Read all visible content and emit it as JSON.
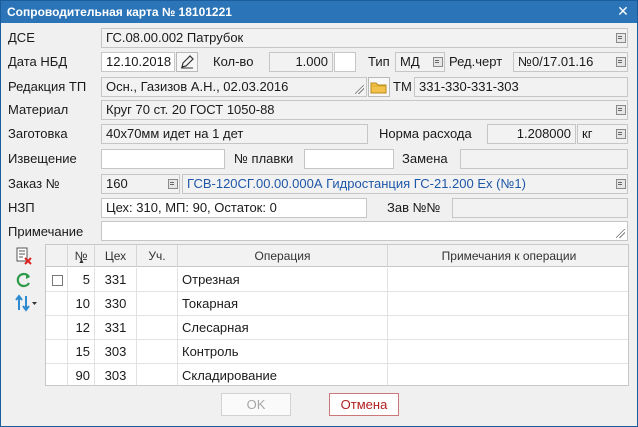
{
  "window": {
    "title": "Сопроводительная карта № 18101221"
  },
  "fields": {
    "dse_label": "ДСЕ",
    "dse_value": "ГС.08.00.002 Патрубок",
    "date_label": "Дата НБД",
    "date_value": "12.10.2018",
    "qty_label": "Кол-во",
    "qty_value": "1.000",
    "type_label": "Тип",
    "type_value": "МД",
    "edchert_label": "Ред.черт",
    "edchert_value": "№0/17.01.16",
    "redtp_label": "Редакция ТП",
    "redtp_value": "Осн., Газизов А.Н., 02.03.2016",
    "tm_label": "ТМ",
    "tm_value": "331-330-331-303",
    "material_label": "Материал",
    "material_value": "Круг 70 ст. 20 ГОСТ 1050-88",
    "zagotovka_label": "Заготовка",
    "zagotovka_value": "40х70мм идет на 1 дет",
    "norma_label": "Норма расхода",
    "norma_value": "1.208000",
    "norma_unit": "кг",
    "izveshenie_label": "Извещение",
    "izveshenie_value": "",
    "plavka_label": "№ плавки",
    "plavka_value": "",
    "zamena_label": "Замена",
    "zamena_value": "",
    "zakaz_label": "Заказ №",
    "zakaz_value": "160",
    "zakaz_desc": "ГСВ-120СГ.00.00.000А Гидростанция ГС-21.200 Ex (№1)",
    "nzp_label": "НЗП",
    "nzp_value": "Цех: 310, МП: 90, Остаток: 0",
    "zav_label": "Зав №№",
    "zav_value": "",
    "prim_label": "Примечание",
    "prim_value": ""
  },
  "table": {
    "headers": [
      "№",
      "Цех",
      "Уч.",
      "Операция",
      "Примечания к операции"
    ],
    "rows": [
      {
        "num": "5",
        "shop": "331",
        "uch": "",
        "op": "Отрезная",
        "note": ""
      },
      {
        "num": "10",
        "shop": "330",
        "uch": "",
        "op": "Токарная",
        "note": ""
      },
      {
        "num": "12",
        "shop": "331",
        "uch": "",
        "op": "Слесарная",
        "note": ""
      },
      {
        "num": "15",
        "shop": "303",
        "uch": "",
        "op": "Контроль",
        "note": ""
      },
      {
        "num": "90",
        "shop": "303",
        "uch": "",
        "op": "Складирование",
        "note": ""
      }
    ]
  },
  "buttons": {
    "ok": "OK",
    "cancel": "Отмена"
  },
  "icons": {
    "close": "close-icon",
    "dropdown": "dropdown-icon",
    "edit": "pen-icon",
    "folder": "folder-icon",
    "resize": "resize-grip-icon",
    "delete_doc": "delete-document-icon",
    "refresh": "refresh-icon",
    "sort": "sort-updown-icon"
  },
  "colors": {
    "titlebar": "#2b74b8",
    "link_text": "#1f57a8",
    "cancel_border": "#c77777"
  }
}
